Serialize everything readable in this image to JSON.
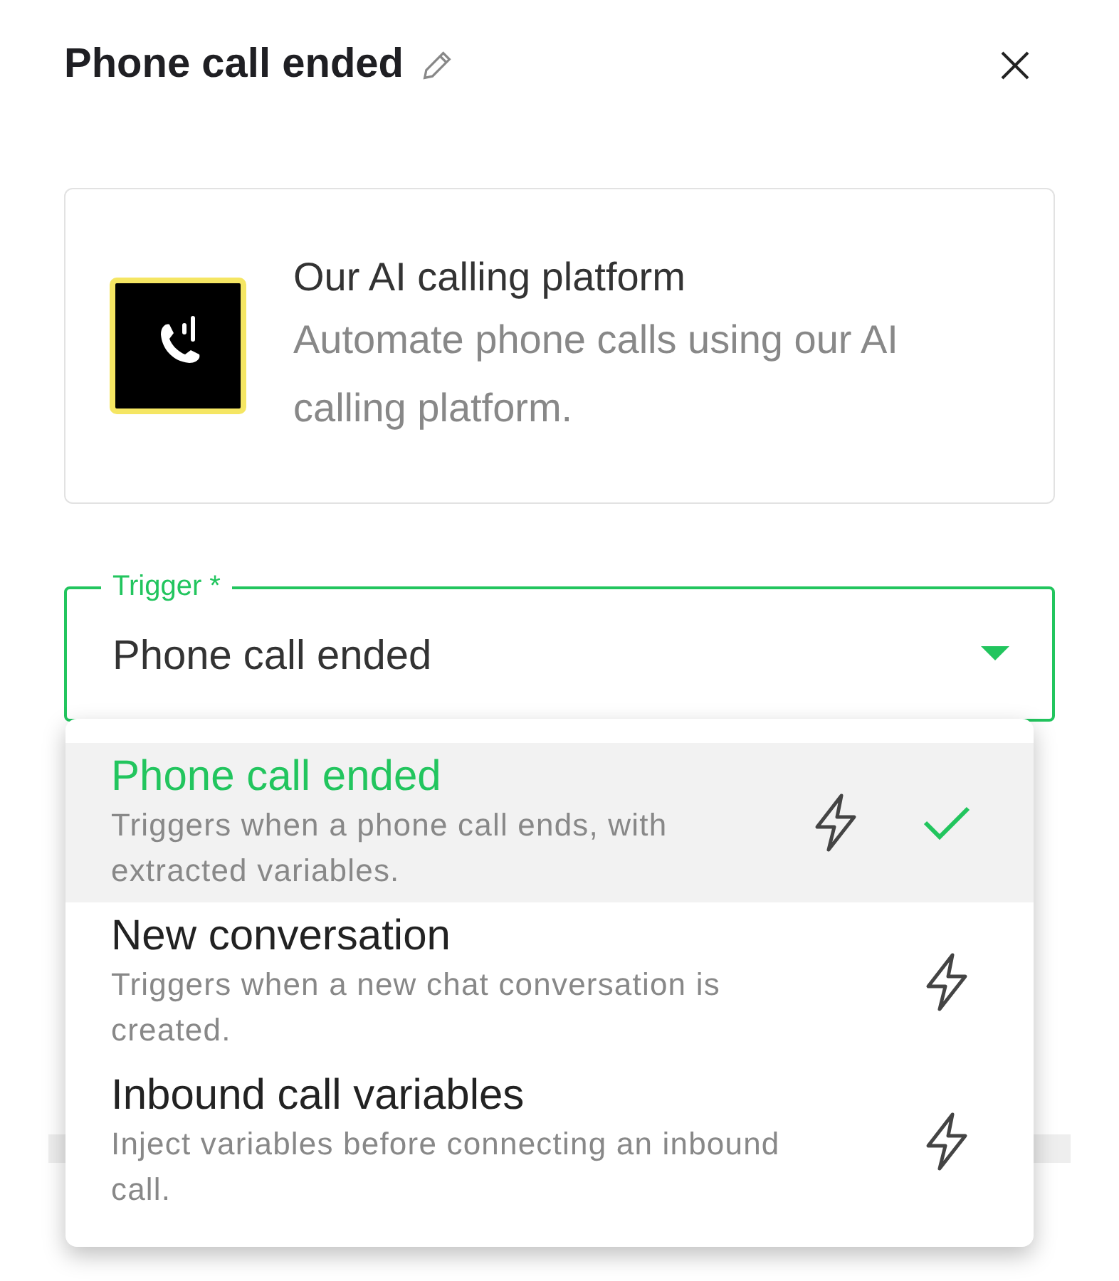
{
  "header": {
    "title": "Phone call ended"
  },
  "integration_card": {
    "title": "Our AI calling platform",
    "description": "Automate phone calls using our AI calling platform."
  },
  "trigger_field": {
    "label": "Trigger *",
    "value": "Phone call ended",
    "expanded": true
  },
  "trigger_options": [
    {
      "title": "Phone call ended",
      "description": "Triggers when a phone call ends, with extracted variables.",
      "selected": true
    },
    {
      "title": "New conversation",
      "description": "Triggers when a new chat conversation is created.",
      "selected": false
    },
    {
      "title": "Inbound call variables",
      "description": "Inject variables before connecting an inbound call.",
      "selected": false
    }
  ]
}
